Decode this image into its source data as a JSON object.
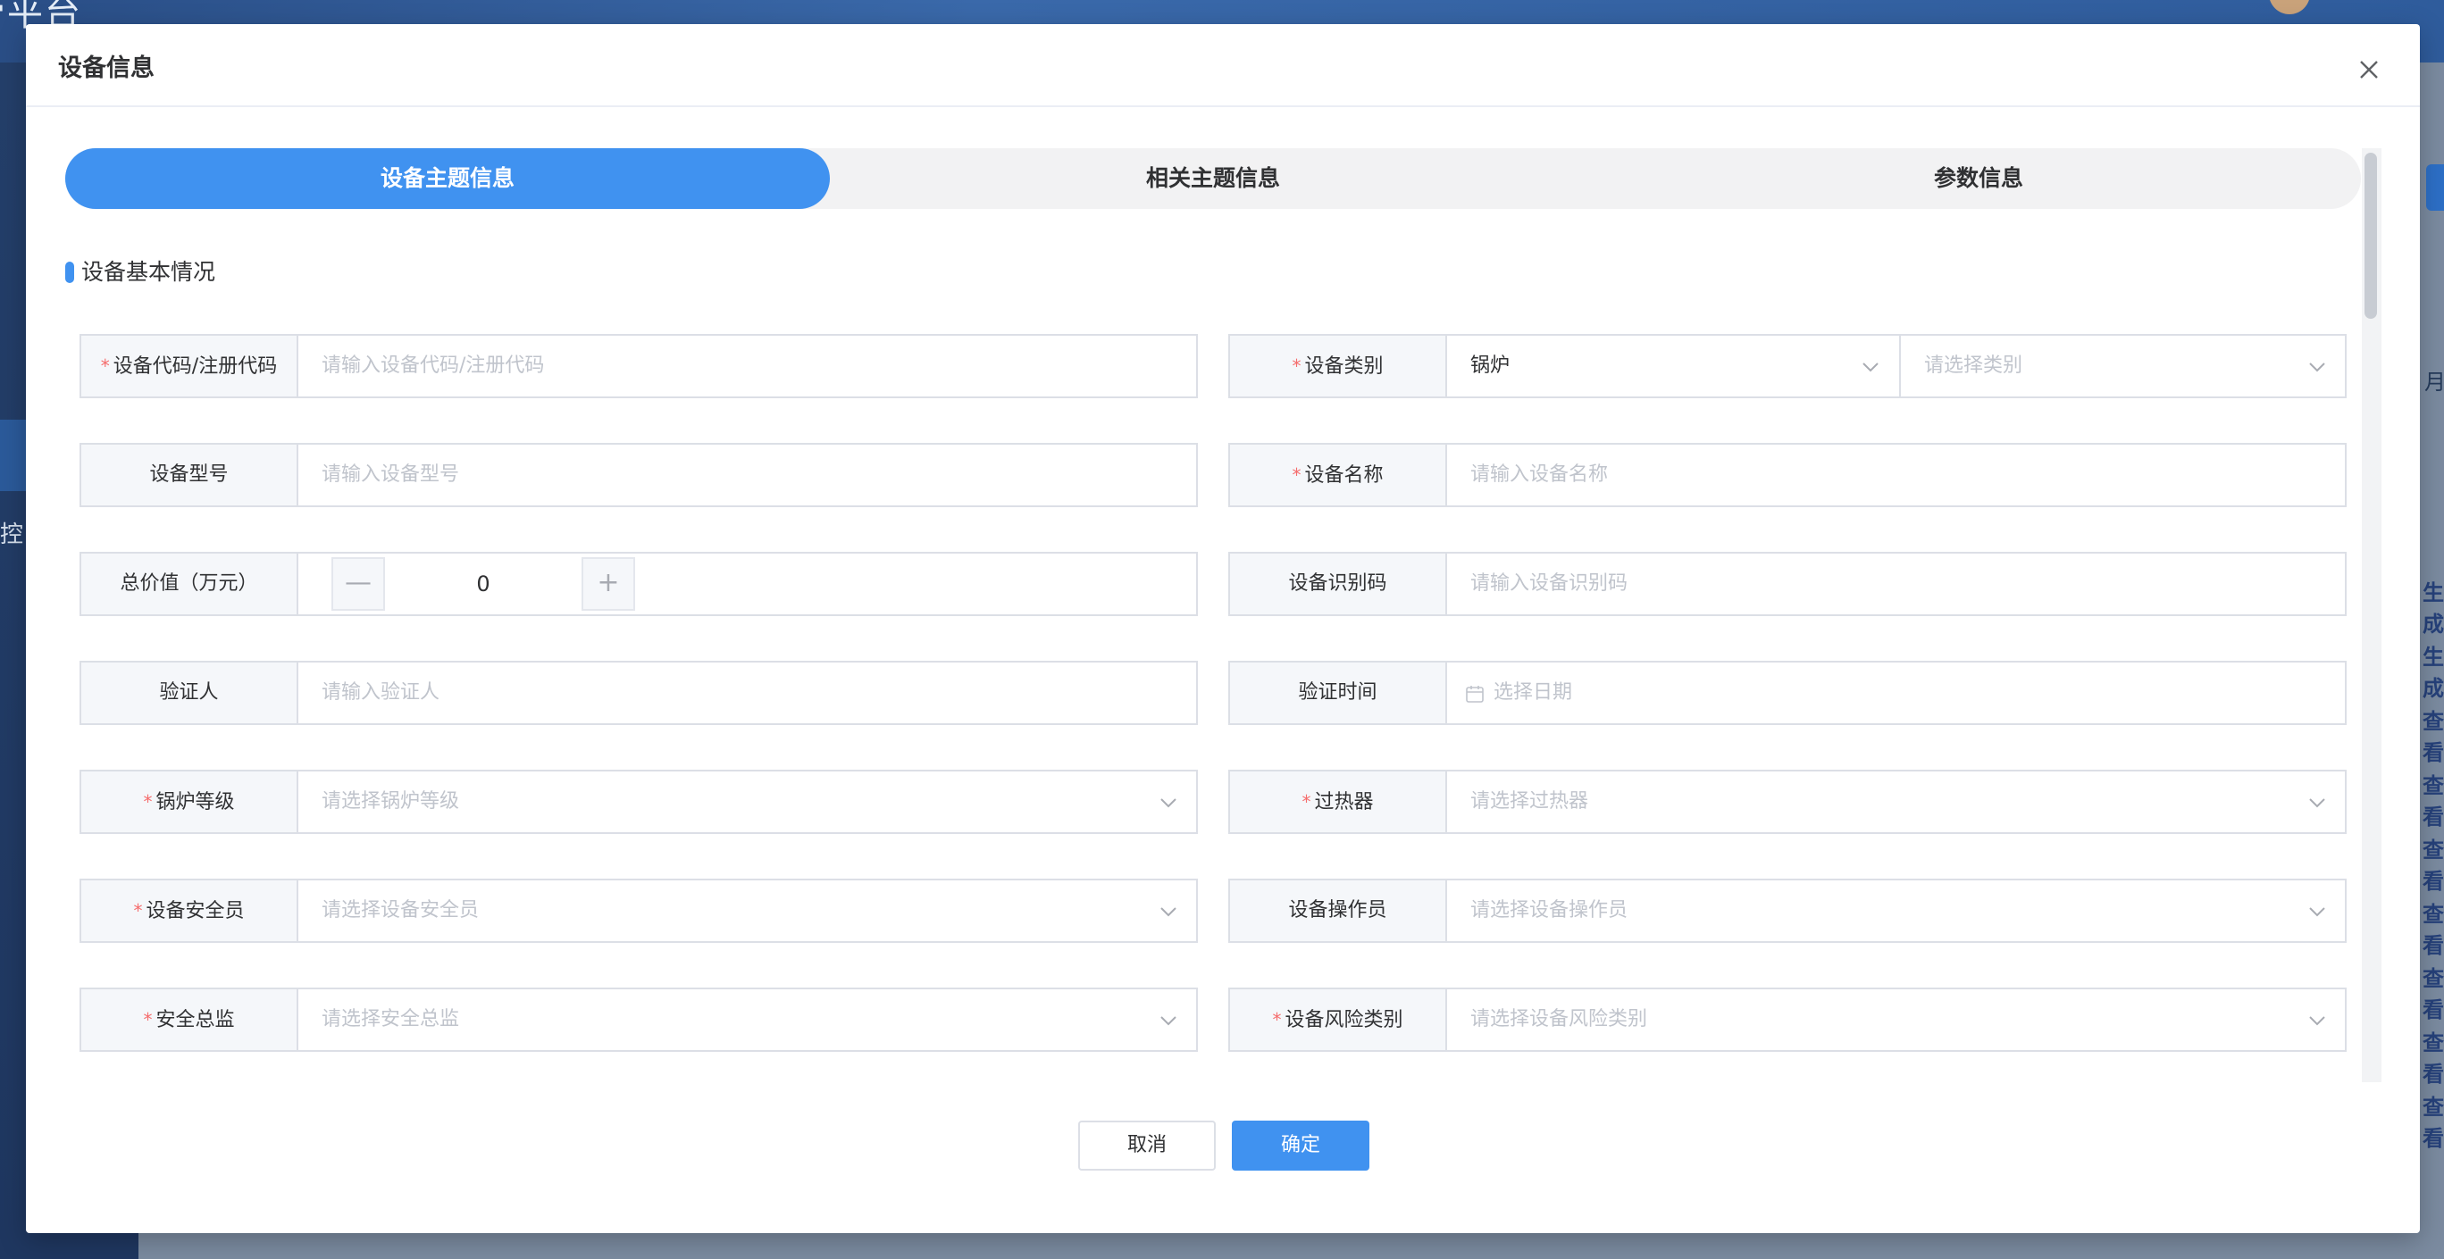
{
  "background": {
    "title_fragment": "管平台",
    "sidebar_fragment": "控",
    "right_column": {
      "month_fragment": "月",
      "labels": [
        "生成",
        "生成",
        "查看",
        "查看",
        "查看",
        "查看",
        "查看",
        "查看",
        "查看"
      ]
    }
  },
  "modal": {
    "title": "设备信息",
    "tabs": [
      {
        "label": "设备主题信息",
        "active": true
      },
      {
        "label": "相关主题信息",
        "active": false
      },
      {
        "label": "参数信息",
        "active": false
      }
    ],
    "section_title": "设备基本情况",
    "fields": {
      "device_code": {
        "label": "设备代码/注册代码",
        "required": true,
        "placeholder": "请输入设备代码/注册代码"
      },
      "device_category": {
        "label": "设备类别",
        "required": true,
        "value": "锅炉",
        "sub_placeholder": "请选择类别"
      },
      "device_model": {
        "label": "设备型号",
        "required": false,
        "placeholder": "请输入设备型号"
      },
      "device_name": {
        "label": "设备名称",
        "required": true,
        "placeholder": "请输入设备名称"
      },
      "total_value": {
        "label": "总价值（万元）",
        "required": false,
        "value": "0",
        "minus": "—",
        "plus": "+"
      },
      "device_id_code": {
        "label": "设备识别码",
        "required": false,
        "placeholder": "请输入设备识别码"
      },
      "verifier": {
        "label": "验证人",
        "required": false,
        "placeholder": "请输入验证人"
      },
      "verify_time": {
        "label": "验证时间",
        "required": false,
        "placeholder": "选择日期"
      },
      "boiler_grade": {
        "label": "锅炉等级",
        "required": true,
        "placeholder": "请选择锅炉等级"
      },
      "superheater": {
        "label": "过热器",
        "required": true,
        "placeholder": "请选择过热器"
      },
      "safety_officer": {
        "label": "设备安全员",
        "required": true,
        "placeholder": "请选择设备安全员"
      },
      "operator": {
        "label": "设备操作员",
        "required": false,
        "placeholder": "请选择设备操作员"
      },
      "safety_director": {
        "label": "安全总监",
        "required": true,
        "placeholder": "请选择安全总监"
      },
      "risk_category": {
        "label": "设备风险类别",
        "required": true,
        "placeholder": "请选择设备风险类别"
      }
    },
    "required_mark": "*",
    "buttons": {
      "cancel": "取消",
      "confirm": "确定"
    }
  },
  "colors": {
    "accent": "#4092f0",
    "required": "#f56c6c",
    "label_bg": "#f5f7fa",
    "border": "#dcdfe6",
    "placeholder": "#c0c4cc"
  }
}
